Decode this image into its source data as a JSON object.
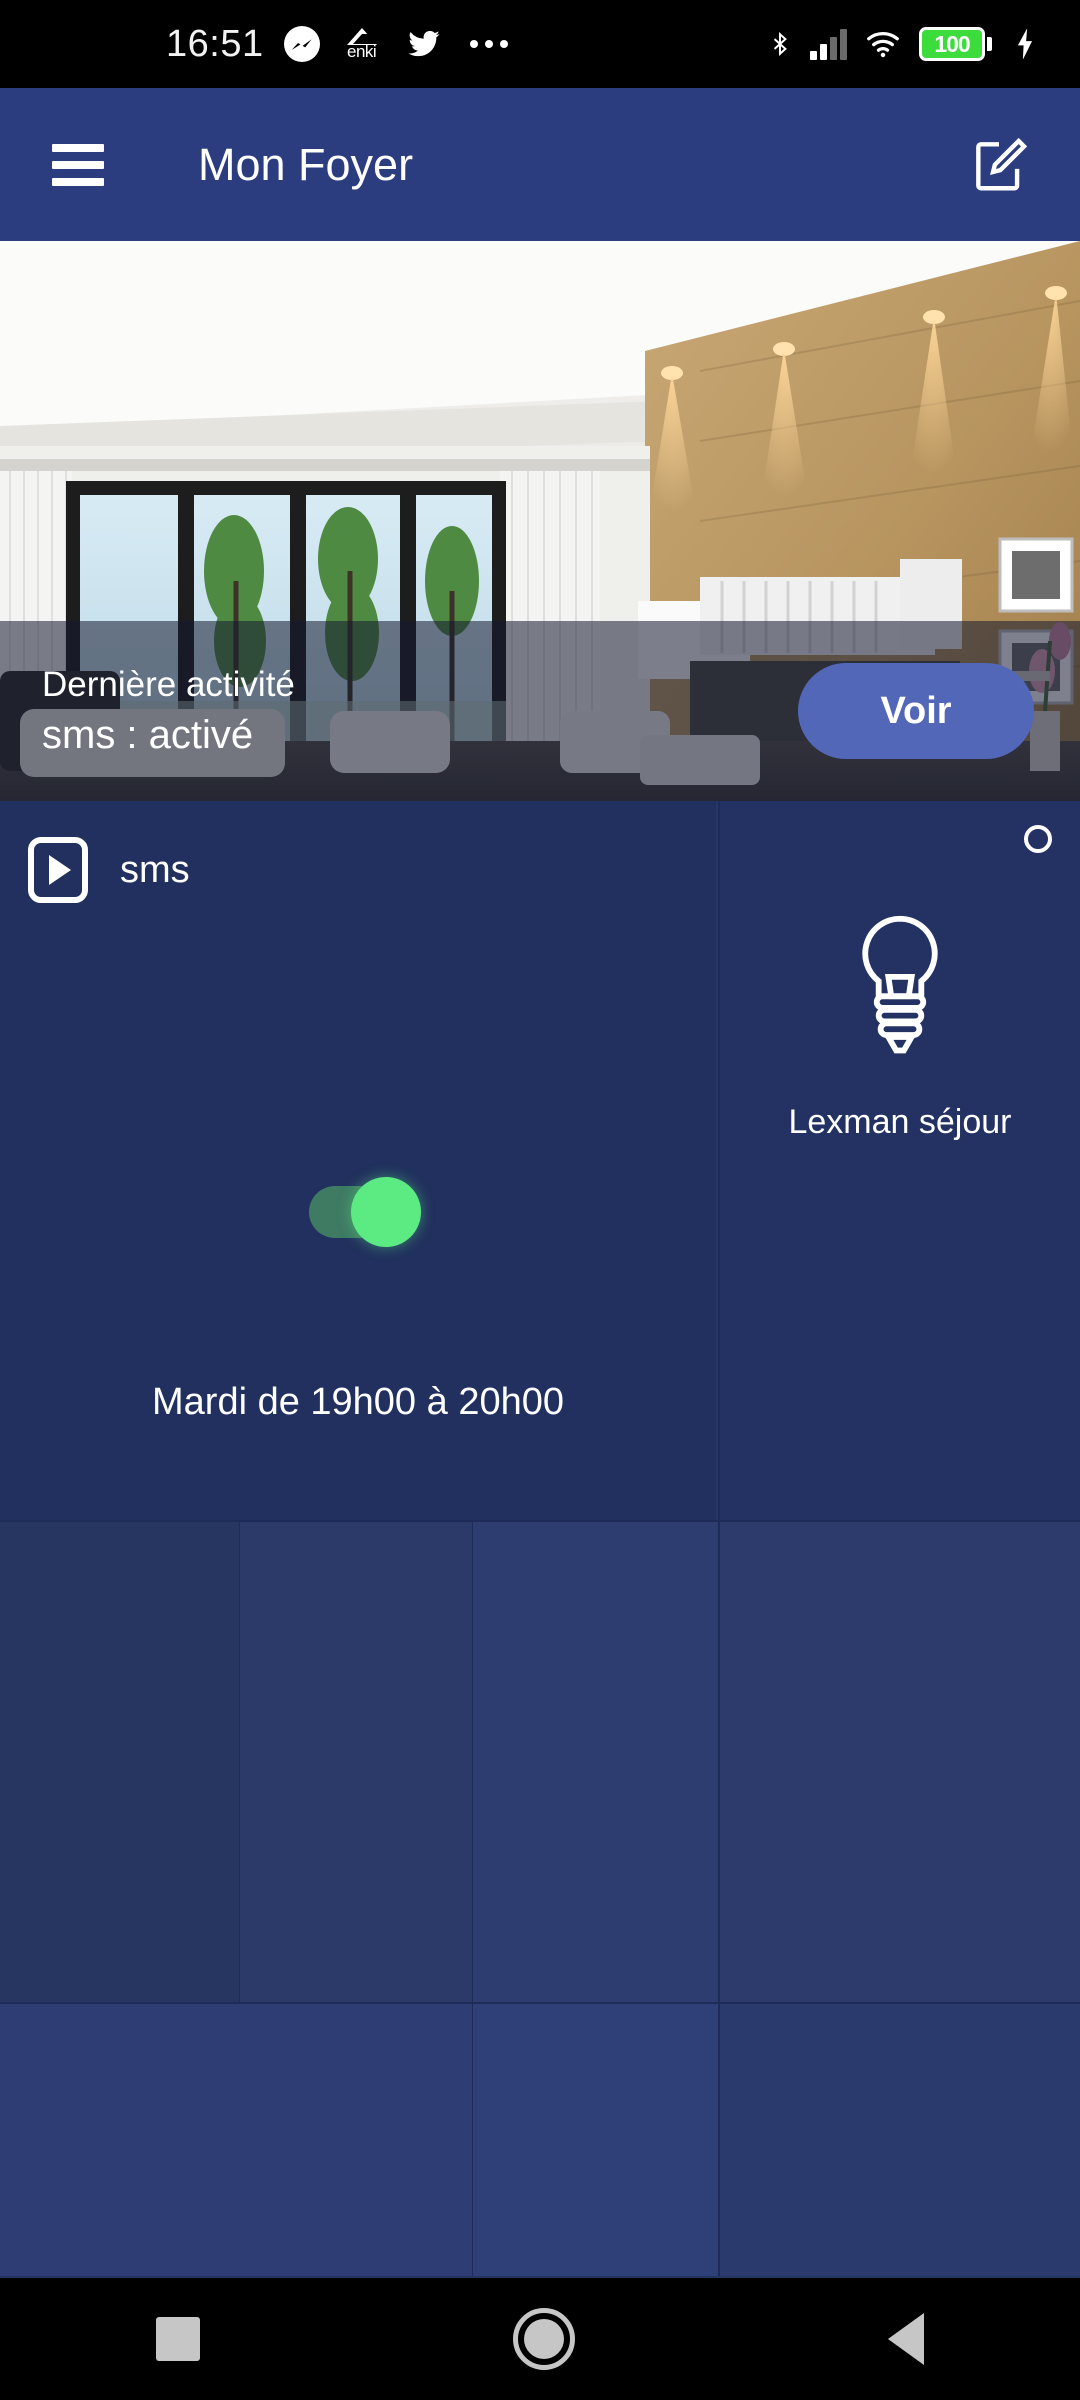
{
  "statusbar": {
    "time": "16:51",
    "app_icons": [
      {
        "name": "messenger-icon",
        "label": ""
      },
      {
        "name": "enki-icon",
        "label": "enki"
      },
      {
        "name": "twitter-icon",
        "label": ""
      },
      {
        "name": "more-notifications-icon",
        "label": "..."
      }
    ],
    "enki_label": "enki",
    "bluetooth": "bluetooth-icon",
    "signal": "cellular-signal-icon",
    "wifi": "wifi-icon",
    "battery_level": "100",
    "battery_charging": true
  },
  "appbar": {
    "menu_icon": "hamburger-menu-icon",
    "title": "Mon Foyer",
    "edit_icon": "edit-pencil-icon"
  },
  "hero": {
    "alt": "living-room-photo",
    "activity_title": "Dernière activité",
    "activity_value": "sms : activé",
    "view_button": "Voir"
  },
  "cards": {
    "sms": {
      "icon": "play-button-icon",
      "label": "sms",
      "toggle_state": "on",
      "schedule": "Mardi de 19h00 à 20h00"
    },
    "light": {
      "icon": "lightbulb-icon",
      "label": "Lexman séjour",
      "power_indicator": "power-circle-icon"
    }
  },
  "navbar": {
    "recents": "recents-square-icon",
    "home": "home-circle-icon",
    "back": "back-triangle-icon"
  },
  "colors": {
    "appbar": "#2c3d7f",
    "background": "#21305e",
    "accent_button": "#5367b8",
    "toggle_on": "#5ceb83",
    "battery_green": "#3ddc3d"
  }
}
